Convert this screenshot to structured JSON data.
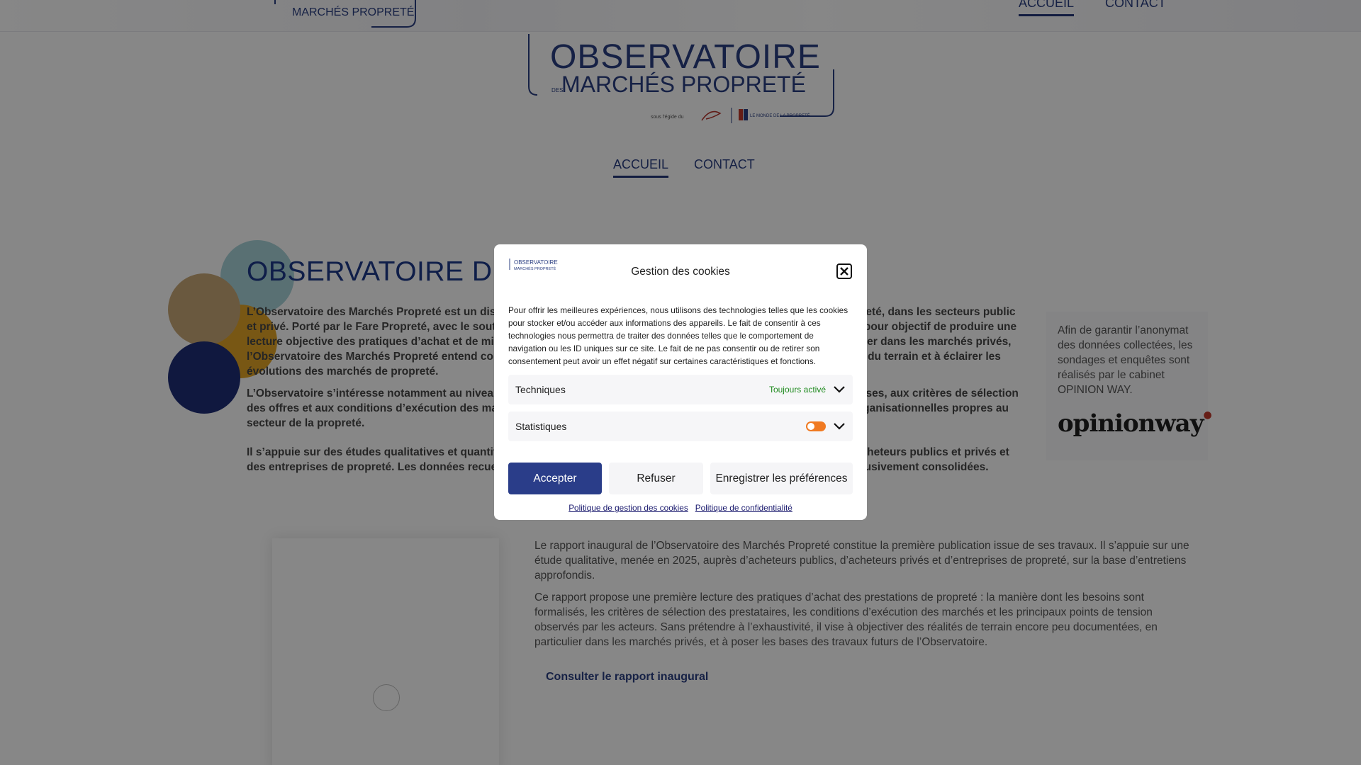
{
  "header": {
    "logo": {
      "line1": "OBSERVATOIRE",
      "des": "DES",
      "line2": "MARCHÉS PROPRETÉ",
      "sponsor_text": "sous l'égide du",
      "partner_text": "LE MONDE DE LA PROPRETÉ"
    },
    "nav": [
      {
        "label": "ACCUEIL",
        "active": true
      },
      {
        "label": "CONTACT",
        "active": false
      }
    ]
  },
  "hero": {
    "title": "OBSERVATOIRE DES MARCHÉS PROPRETÉ"
  },
  "intro": {
    "paragraphs": [
      "L’Observatoire des Marchés Propreté est un dispositif d’observation et d’analyse des marchés de prestations de propreté, dans les secteurs public et privé. Porté par le Fare Propreté, avec le soutien éditorial du Monde de la Propreté et des acteurs de la branche, il a pour objectif de produire une lecture objective des pratiques d’achat et de mise en œuvre de prestations de propreté encore peu lisibles, en particulier dans les marchés privés, l’Observatoire des Marchés Propreté entend contribuer à une meilleure connaissance partagée, fondée sur les réalités du terrain et à éclairer les évolutions des marchés de propreté.",
      "L’Observatoire s’intéresse notamment au niveau d’exigences et de qualité attendu des acheteurs vis-à-vis des entreprises, aux critères de sélection des offres et aux conditions d’exécution des marchés, ainsi qu’aux transformations sociales, environnementales et organisationnelles propres au secteur de la propreté.",
      "Il s’appuie sur des études qualitatives et quantitatives conduites de manière indépendante et périodique auprès des acheteurs publics et privés et des entreprises de propreté. Les données recueillies sont traitées de façon anonyme et font l’objet de restitutions exclusivement consolidées."
    ]
  },
  "side_card": {
    "text": "Afin de garantir l’anonymat des données collectées, les sondages et enquêtes sont réalisés par le cabinet OPINION WAY.",
    "logo_text": "opinionway"
  },
  "report": {
    "paragraphs": [
      "Le rapport inaugural de l’Observatoire des Marchés Propreté constitue la première publication issue de ses travaux. Il s’appuie sur une étude qualitative, menée en 2025, auprès d’acheteurs publics, d’acheteurs privés et d’entreprises de propreté, sur la base d’entretiens approfondis.",
      "Ce rapport propose une première lecture des pratiques d’achat des prestations de propreté : la manière dont les besoins sont formalisés, les critères de sélection des prestataires, les conditions d’exécution des marchés et les principaux points de tension observés par les acteurs. Sans prétendre à l’exhaustivité, il vise à objectiver des réalités de terrain encore peu documentées, en particulier dans les marchés privés, et à poser les bases des travaux futurs de l’Observatoire."
    ],
    "link_label": "Consulter le rapport inaugural"
  },
  "cookie_dialog": {
    "title": "Gestion des cookies",
    "body": "Pour offrir les meilleures expériences, nous utilisons des technologies telles que les cookies pour stocker et/ou accéder aux informations des appareils. Le fait de consentir à ces technologies nous permettra de traiter des données telles que le comportement de navigation ou les ID uniques sur ce site. Le fait de ne pas consentir ou de retirer son consentement peut avoir un effet négatif sur certaines caractéristiques et fonctions.",
    "categories": [
      {
        "label": "Techniques",
        "status": "Toujours activé"
      },
      {
        "label": "Statistiques",
        "status": ""
      }
    ],
    "buttons": {
      "accept": "Accepter",
      "refuse": "Refuser",
      "save": "Enregistrer les préférences"
    },
    "links": {
      "cookie_policy": "Politique de gestion des cookies",
      "privacy_policy": "Politique de confidentialité"
    }
  },
  "colors": {
    "brand_blue": "#2a3d89",
    "title_blue": "#1e3a8a",
    "toggle_orange": "#f07a22",
    "always_on_green": "#1e8a1e",
    "circle_teal": "#a8d3d9",
    "circle_tan": "#c9a878",
    "circle_gold": "#e3a526",
    "circle_navy": "#1f2f78"
  }
}
